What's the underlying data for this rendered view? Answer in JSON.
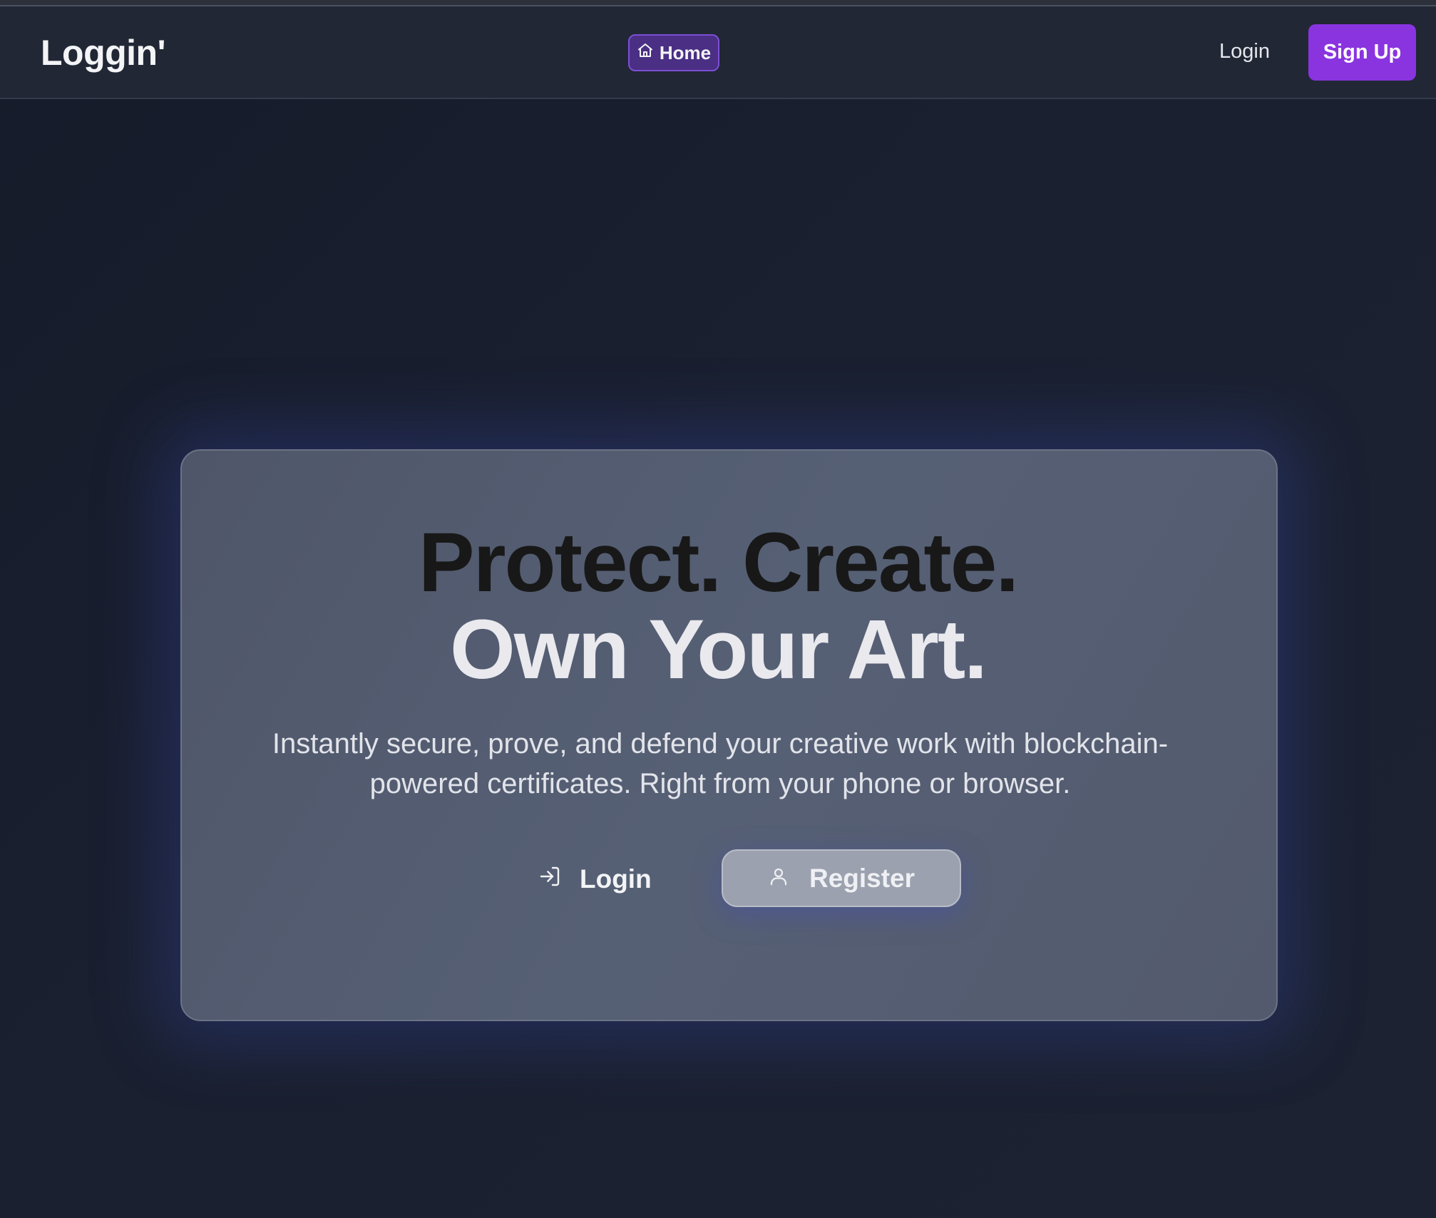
{
  "navbar": {
    "brand": "Loggin'",
    "home_label": "Home",
    "login_label": "Login",
    "signup_label": "Sign Up"
  },
  "hero": {
    "headline_line1": "Protect. Create.",
    "headline_line2": "Own Your Art.",
    "subtitle": "Instantly secure, prove, and defend your creative work with blockchain-powered certificates. Right from your phone or browser.",
    "login_label": "Login",
    "register_label": "Register"
  },
  "icons": {
    "home": "home-icon",
    "login": "login-arrow-icon",
    "register": "user-icon"
  },
  "colors": {
    "accent": "#8a34e0",
    "home_pill_bg": "#4a2f84",
    "home_pill_border": "#7c4fd6",
    "background": "#1a2030",
    "card": "#545b6e"
  }
}
